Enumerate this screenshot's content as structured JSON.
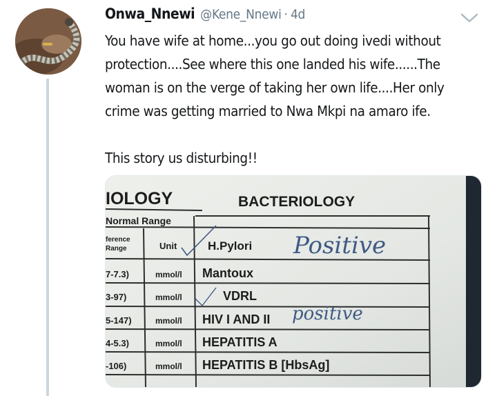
{
  "tweet": {
    "display_name": "Onwa_Nnewi",
    "handle": "@Kene_Nnewi",
    "separator": "·",
    "time": "4d",
    "lines": [
      "You have wife at home...you go out doing ivedi without",
      "protection....See where this one landed his wife......The",
      "woman is on the verge of taking her own life....Her only",
      "crime was getting married to Nwa Mkpi na amaro ife."
    ],
    "line_after_gap": "This story us disturbing!!"
  },
  "lab_report": {
    "left_header": "IOLOGY",
    "header": "BACTERIOLOGY",
    "normal_range": "Normal Range",
    "reference_range": [
      "ference",
      "Range"
    ],
    "unit_label": "Unit",
    "rows": [
      {
        "range": "7-7.3)",
        "unit": "mmol/l",
        "test": "Mantoux",
        "result": ""
      },
      {
        "range": "3-97)",
        "unit": "mmol/l",
        "test": "VDRL",
        "result": ""
      },
      {
        "range": "5-147)",
        "unit": "mmol/l",
        "test": "HIV I AND II",
        "result": "positive"
      },
      {
        "range": "4-5.3)",
        "unit": "mmol/l",
        "test": "HEPATITIS A",
        "result": ""
      },
      {
        "range": "-106)",
        "unit": "mmol/l",
        "test": "HEPATITIS B [HbsAg]",
        "result": ""
      }
    ],
    "first_test": "H.Pylori",
    "first_result": "Positive"
  },
  "colors": {
    "text": "#14171a",
    "secondary": "#657786",
    "thread_line": "#ccd6dd",
    "ink": "#3f5a84"
  }
}
